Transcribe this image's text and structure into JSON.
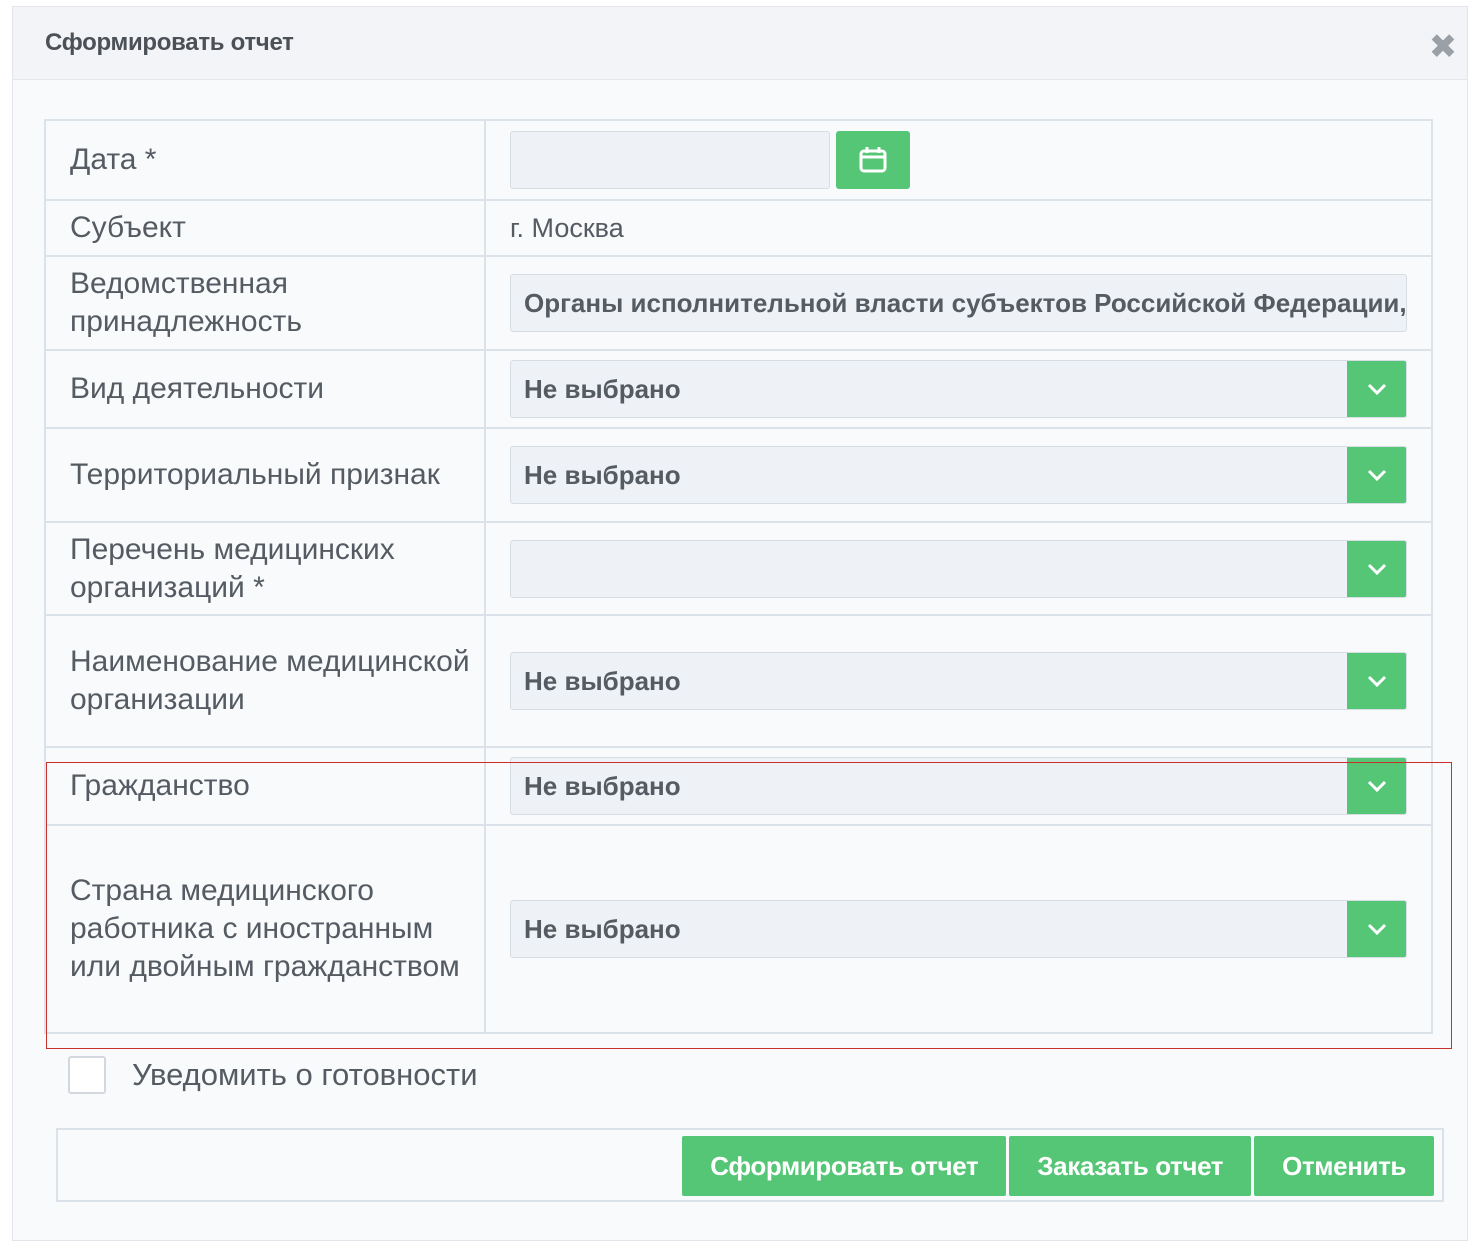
{
  "dialog": {
    "title": "Сформировать отчет",
    "close_symbol": "✖"
  },
  "form": {
    "date": {
      "label": "Дата *",
      "value": "",
      "calendar_icon": "calendar-icon"
    },
    "subject": {
      "label": "Субъект",
      "value": "г. Москва"
    },
    "department": {
      "label": "Ведомственная принадлежность",
      "value": "Органы исполнительной власти субъектов Российской Федерации, ос"
    },
    "activity": {
      "label": "Вид деятельности",
      "value": "Не выбрано"
    },
    "territory": {
      "label": "Территориальный признак",
      "value": "Не выбрано"
    },
    "org_list": {
      "label": "Перечень медицинских организаций *",
      "value": ""
    },
    "org_name": {
      "label": "Наименование медицинской организации",
      "value": "Не выбрано"
    },
    "citizenship": {
      "label": "Гражданство",
      "value": "Не выбрано"
    },
    "country": {
      "label": "Страна медицинского работника с иностранным или двойным гражданством",
      "value": "Не выбрано"
    }
  },
  "notify": {
    "label": "Уведомить о готовности",
    "checked": false
  },
  "buttons": {
    "generate": "Сформировать отчет",
    "order": "Заказать отчет",
    "cancel": "Отменить"
  },
  "colors": {
    "accent": "#55c676",
    "highlight": "#c9302c"
  }
}
